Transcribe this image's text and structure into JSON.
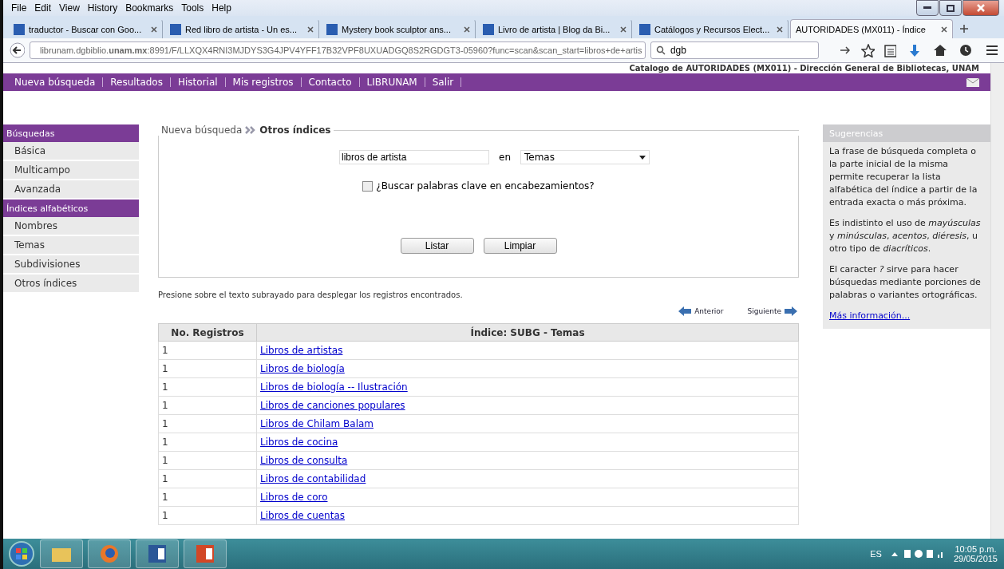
{
  "menu_bar": [
    "File",
    "Edit",
    "View",
    "History",
    "Bookmarks",
    "Tools",
    "Help"
  ],
  "tabs": [
    {
      "label": "traductor - Buscar con Goo...",
      "selected": false
    },
    {
      "label": "Red libro de artista - Un es...",
      "selected": false
    },
    {
      "label": "Mystery book sculptor ans...",
      "selected": false
    },
    {
      "label": "Livro de artista | Blog da Bi...",
      "selected": false
    },
    {
      "label": "Catálogos y Recursos Elect...",
      "selected": false
    },
    {
      "label": "AUTORIDADES (MX011) - Índice",
      "selected": true
    }
  ],
  "address": {
    "url": "librunam.dgbiblio.**unam.mx**:8991/F/LLXQX4RNI3MJDYS3G4JPV4YFF17B32VPF8UXUADGQ8S2RGDGT3-05960?func=scan&scan_start=libros+de+artis",
    "search": "dgb"
  },
  "site_header": "Catalogo de AUTORIDADES (MX011) - Dirección General de Bibliotecas, UNAM",
  "nav": [
    "Nueva búsqueda",
    "Resultados",
    "Historial",
    "Mis registros",
    "Contacto",
    "LIBRUNAM",
    "Salir"
  ],
  "sidebar": [
    {
      "heading": "Búsquedas",
      "items": [
        "Básica",
        "Multicampo",
        "Avanzada"
      ]
    },
    {
      "heading": "Índices alfabéticos",
      "items": [
        "Nombres",
        "Temas",
        "Subdivisiones",
        "Otros índices"
      ]
    }
  ],
  "breadcrumb": {
    "parent": "Nueva búsqueda",
    "current": "Otros índices"
  },
  "form": {
    "query": "libros de artista",
    "in_label": "en",
    "index": "Temas",
    "keyword_checkbox": {
      "label": "¿Buscar palabras clave en encabezamientos?",
      "checked": false
    },
    "buttons": [
      "Listar",
      "Limpiar"
    ]
  },
  "hint": "Presione sobre el texto subrayado para desplegar los registros encontrados.",
  "pager": {
    "previous": "Anterior",
    "next": "Siguiente"
  },
  "table": {
    "columns": [
      "No. Registros",
      "Índice: SUBG - Temas"
    ],
    "rows": [
      [
        "1",
        "Libros de artistas"
      ],
      [
        "1",
        "Libros de biología"
      ],
      [
        "1",
        "Libros de biología -- Ilustración"
      ],
      [
        "1",
        "Libros de canciones populares"
      ],
      [
        "1",
        "Libros de Chilam Balam"
      ],
      [
        "1",
        "Libros de cocina"
      ],
      [
        "1",
        "Libros de consulta"
      ],
      [
        "1",
        "Libros de contabilidad"
      ],
      [
        "1",
        "Libros de coro"
      ],
      [
        "1",
        "Libros de cuentas"
      ]
    ]
  },
  "suggestions": {
    "title": "Sugerencias",
    "paragraphs": [
      "La frase de búsqueda completa o la parte inicial de la misma permite recuperar la lista alfabética del índice a partir de la entrada exacta o más próxima.",
      "Es indistinto el uso de *mayúsculas* y *minúsculas*, *acentos*, *diéresis*, u otro tipo de *diacríticos*.",
      "El caracter *?* sirve para hacer búsquedas mediante porciones de palabras o variantes ortográficas."
    ],
    "link": "Más información..."
  },
  "taskbar": {
    "language": "ES",
    "time": "10:05 p.m.",
    "date": "29/05/2015"
  }
}
